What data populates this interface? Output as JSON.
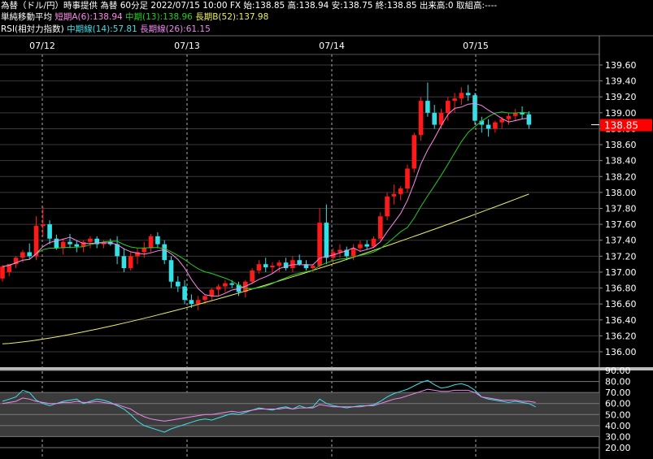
{
  "header": {
    "line1": "為替（ドル/円）時事提供 為替 60分足 2022/07/15 10:00 FX 始:138.85 高:138.94 安:138.75 終:138.85 出来高:0 取組高:----",
    "ma_title": "単純移動平均",
    "ma_a": "短期A(6):138.94",
    "ma_b": "中期(13):138.96",
    "ma_c": "長期B(52):137.98",
    "rsi_title": "RSI(相対力指数)",
    "rsi_mid": "中期線(14):57.81",
    "rsi_long": "長期線(26):61.15"
  },
  "colors": {
    "background": "#000000",
    "up": "#ff1a1a",
    "down": "#33e0e6",
    "ma_short": "#ff88ee",
    "ma_mid": "#22cc22",
    "ma_long": "#eeee66",
    "rsi_mid": "#40e0e8",
    "rsi_long": "#ee88ee",
    "price_tag": "#ff0000"
  },
  "chart_data": [
    {
      "type": "candlestick",
      "dates": [
        "07/12",
        "07/13",
        "07/14",
        "07/15"
      ],
      "ylim": [
        136.0,
        139.6
      ],
      "yticks": [
        "139.60",
        "139.40",
        "139.20",
        "139.00",
        "138.80",
        "138.60",
        "138.40",
        "138.20",
        "138.00",
        "137.80",
        "137.60",
        "137.40",
        "137.20",
        "137.00",
        "136.80",
        "136.60",
        "136.40",
        "136.20",
        "136.00"
      ],
      "current_price": "138.85",
      "series": [
        {
          "name": "短期A(6)",
          "kind": "ma"
        },
        {
          "name": "中期(13)",
          "kind": "ma"
        },
        {
          "name": "長期B(52)",
          "kind": "ma"
        }
      ],
      "ohlc": [
        [
          136.92,
          137.09,
          136.88,
          137.07
        ],
        [
          137.0,
          137.1,
          136.95,
          137.1
        ],
        [
          137.1,
          137.2,
          137.05,
          137.18
        ],
        [
          137.18,
          137.28,
          137.12,
          137.25
        ],
        [
          137.25,
          137.36,
          137.17,
          137.2
        ],
        [
          137.2,
          137.7,
          137.15,
          137.58
        ],
        [
          137.58,
          137.82,
          137.45,
          137.6
        ],
        [
          137.6,
          137.65,
          137.35,
          137.42
        ],
        [
          137.42,
          137.47,
          137.28,
          137.3
        ],
        [
          137.3,
          137.42,
          137.22,
          137.38
        ],
        [
          137.38,
          137.48,
          137.3,
          137.35
        ],
        [
          137.35,
          137.4,
          137.25,
          137.32
        ],
        [
          137.32,
          137.4,
          137.25,
          137.38
        ],
        [
          137.38,
          137.45,
          137.3,
          137.42
        ],
        [
          137.42,
          137.45,
          137.3,
          137.35
        ],
        [
          137.35,
          137.4,
          137.3,
          137.38
        ],
        [
          137.38,
          137.42,
          137.33,
          137.35
        ],
        [
          137.35,
          137.45,
          137.1,
          137.2
        ],
        [
          137.2,
          137.3,
          137.0,
          137.05
        ],
        [
          137.05,
          137.25,
          137.02,
          137.2
        ],
        [
          137.2,
          137.3,
          137.1,
          137.25
        ],
        [
          137.25,
          137.38,
          137.18,
          137.3
        ],
        [
          137.3,
          137.48,
          137.25,
          137.45
        ],
        [
          137.45,
          137.5,
          137.3,
          137.35
        ],
        [
          137.35,
          137.4,
          137.1,
          137.15
        ],
        [
          137.15,
          137.2,
          136.8,
          136.88
        ],
        [
          136.88,
          136.95,
          136.75,
          136.82
        ],
        [
          136.82,
          136.9,
          136.6,
          136.65
        ],
        [
          136.65,
          136.72,
          136.55,
          136.6
        ],
        [
          136.6,
          136.7,
          136.52,
          136.65
        ],
        [
          136.65,
          136.72,
          136.6,
          136.7
        ],
        [
          136.7,
          136.8,
          136.65,
          136.78
        ],
        [
          136.78,
          136.85,
          136.7,
          136.82
        ],
        [
          136.82,
          136.9,
          136.75,
          136.86
        ],
        [
          136.86,
          136.9,
          136.8,
          136.84
        ],
        [
          136.84,
          136.88,
          136.7,
          136.75
        ],
        [
          136.75,
          136.9,
          136.68,
          136.88
        ],
        [
          136.88,
          137.05,
          136.85,
          137.02
        ],
        [
          137.02,
          137.15,
          136.98,
          137.1
        ],
        [
          137.1,
          137.18,
          137.0,
          137.06
        ],
        [
          137.06,
          137.12,
          136.98,
          137.08
        ],
        [
          137.08,
          137.15,
          137.0,
          137.12
        ],
        [
          137.12,
          137.18,
          137.02,
          137.05
        ],
        [
          137.05,
          137.2,
          137.0,
          137.15
        ],
        [
          137.15,
          137.22,
          137.08,
          137.1
        ],
        [
          137.1,
          137.15,
          137.02,
          137.05
        ],
        [
          137.05,
          137.1,
          137.0,
          137.08
        ],
        [
          137.08,
          137.8,
          137.05,
          137.62
        ],
        [
          137.62,
          137.85,
          137.1,
          137.18
        ],
        [
          137.18,
          137.3,
          137.1,
          137.25
        ],
        [
          137.25,
          137.35,
          137.18,
          137.28
        ],
        [
          137.28,
          137.32,
          137.15,
          137.2
        ],
        [
          137.2,
          137.35,
          137.15,
          137.3
        ],
        [
          137.3,
          137.4,
          137.25,
          137.35
        ],
        [
          137.35,
          137.4,
          137.28,
          137.32
        ],
        [
          137.32,
          137.45,
          137.3,
          137.42
        ],
        [
          137.42,
          137.75,
          137.4,
          137.7
        ],
        [
          137.7,
          138.0,
          137.65,
          137.95
        ],
        [
          137.95,
          138.1,
          137.85,
          137.98
        ],
        [
          137.98,
          138.08,
          137.9,
          138.05
        ],
        [
          138.05,
          138.35,
          138.0,
          138.3
        ],
        [
          138.3,
          138.75,
          138.25,
          138.72
        ],
        [
          138.72,
          139.2,
          138.65,
          139.15
        ],
        [
          139.15,
          139.38,
          138.95,
          139.0
        ],
        [
          139.0,
          139.1,
          138.8,
          138.85
        ],
        [
          138.85,
          139.05,
          138.8,
          139.0
        ],
        [
          139.0,
          139.2,
          138.9,
          139.15
        ],
        [
          139.15,
          139.25,
          139.0,
          139.18
        ],
        [
          139.18,
          139.32,
          139.1,
          139.25
        ],
        [
          139.25,
          139.35,
          139.15,
          139.22
        ],
        [
          139.22,
          139.25,
          138.85,
          138.9
        ],
        [
          138.9,
          138.95,
          138.75,
          138.85
        ],
        [
          138.85,
          138.92,
          138.7,
          138.8
        ],
        [
          138.8,
          138.9,
          138.75,
          138.88
        ],
        [
          138.88,
          138.95,
          138.8,
          138.92
        ],
        [
          138.92,
          139.0,
          138.85,
          138.96
        ],
        [
          138.96,
          139.05,
          138.9,
          139.0
        ],
        [
          139.0,
          139.08,
          138.92,
          138.98
        ],
        [
          138.98,
          139.02,
          138.8,
          138.85
        ]
      ]
    },
    {
      "type": "line",
      "title": "RSI(相対力指数)",
      "ylim": [
        20,
        90
      ],
      "yticks": [
        "90.00",
        "80.00",
        "70.00",
        "60.00",
        "50.00",
        "40.00",
        "30.00",
        "20.00"
      ],
      "series": [
        {
          "name": "中期線(14)",
          "values": [
            62,
            64,
            66,
            72,
            70,
            63,
            60,
            58,
            60,
            62,
            63,
            64,
            60,
            62,
            64,
            63,
            61,
            58,
            55,
            50,
            44,
            40,
            38,
            36,
            34,
            37,
            39,
            41,
            43,
            45,
            46,
            45,
            47,
            49,
            51,
            50,
            52,
            54,
            56,
            55,
            54,
            56,
            57,
            55,
            58,
            56,
            57,
            64,
            60,
            58,
            57,
            56,
            57,
            58,
            58,
            59,
            62,
            66,
            69,
            71,
            73,
            76,
            79,
            81,
            77,
            74,
            75,
            77,
            78,
            76,
            72,
            66,
            64,
            63,
            62,
            61,
            62,
            61,
            60,
            57
          ]
        },
        {
          "name": "長期線(26)",
          "values": [
            60,
            61,
            62,
            65,
            64,
            62,
            61,
            60,
            60,
            61,
            61,
            62,
            61,
            61,
            62,
            61,
            60,
            59,
            57,
            55,
            51,
            48,
            46,
            45,
            44,
            45,
            46,
            47,
            48,
            49,
            50,
            50,
            51,
            52,
            53,
            52,
            53,
            54,
            55,
            55,
            55,
            55,
            56,
            55,
            56,
            56,
            56,
            59,
            58,
            57,
            57,
            57,
            57,
            57,
            58,
            58,
            60,
            62,
            64,
            65,
            67,
            69,
            71,
            73,
            72,
            71,
            71,
            72,
            72,
            72,
            70,
            66,
            65,
            64,
            63,
            63,
            63,
            62,
            62,
            61
          ]
        }
      ]
    }
  ]
}
